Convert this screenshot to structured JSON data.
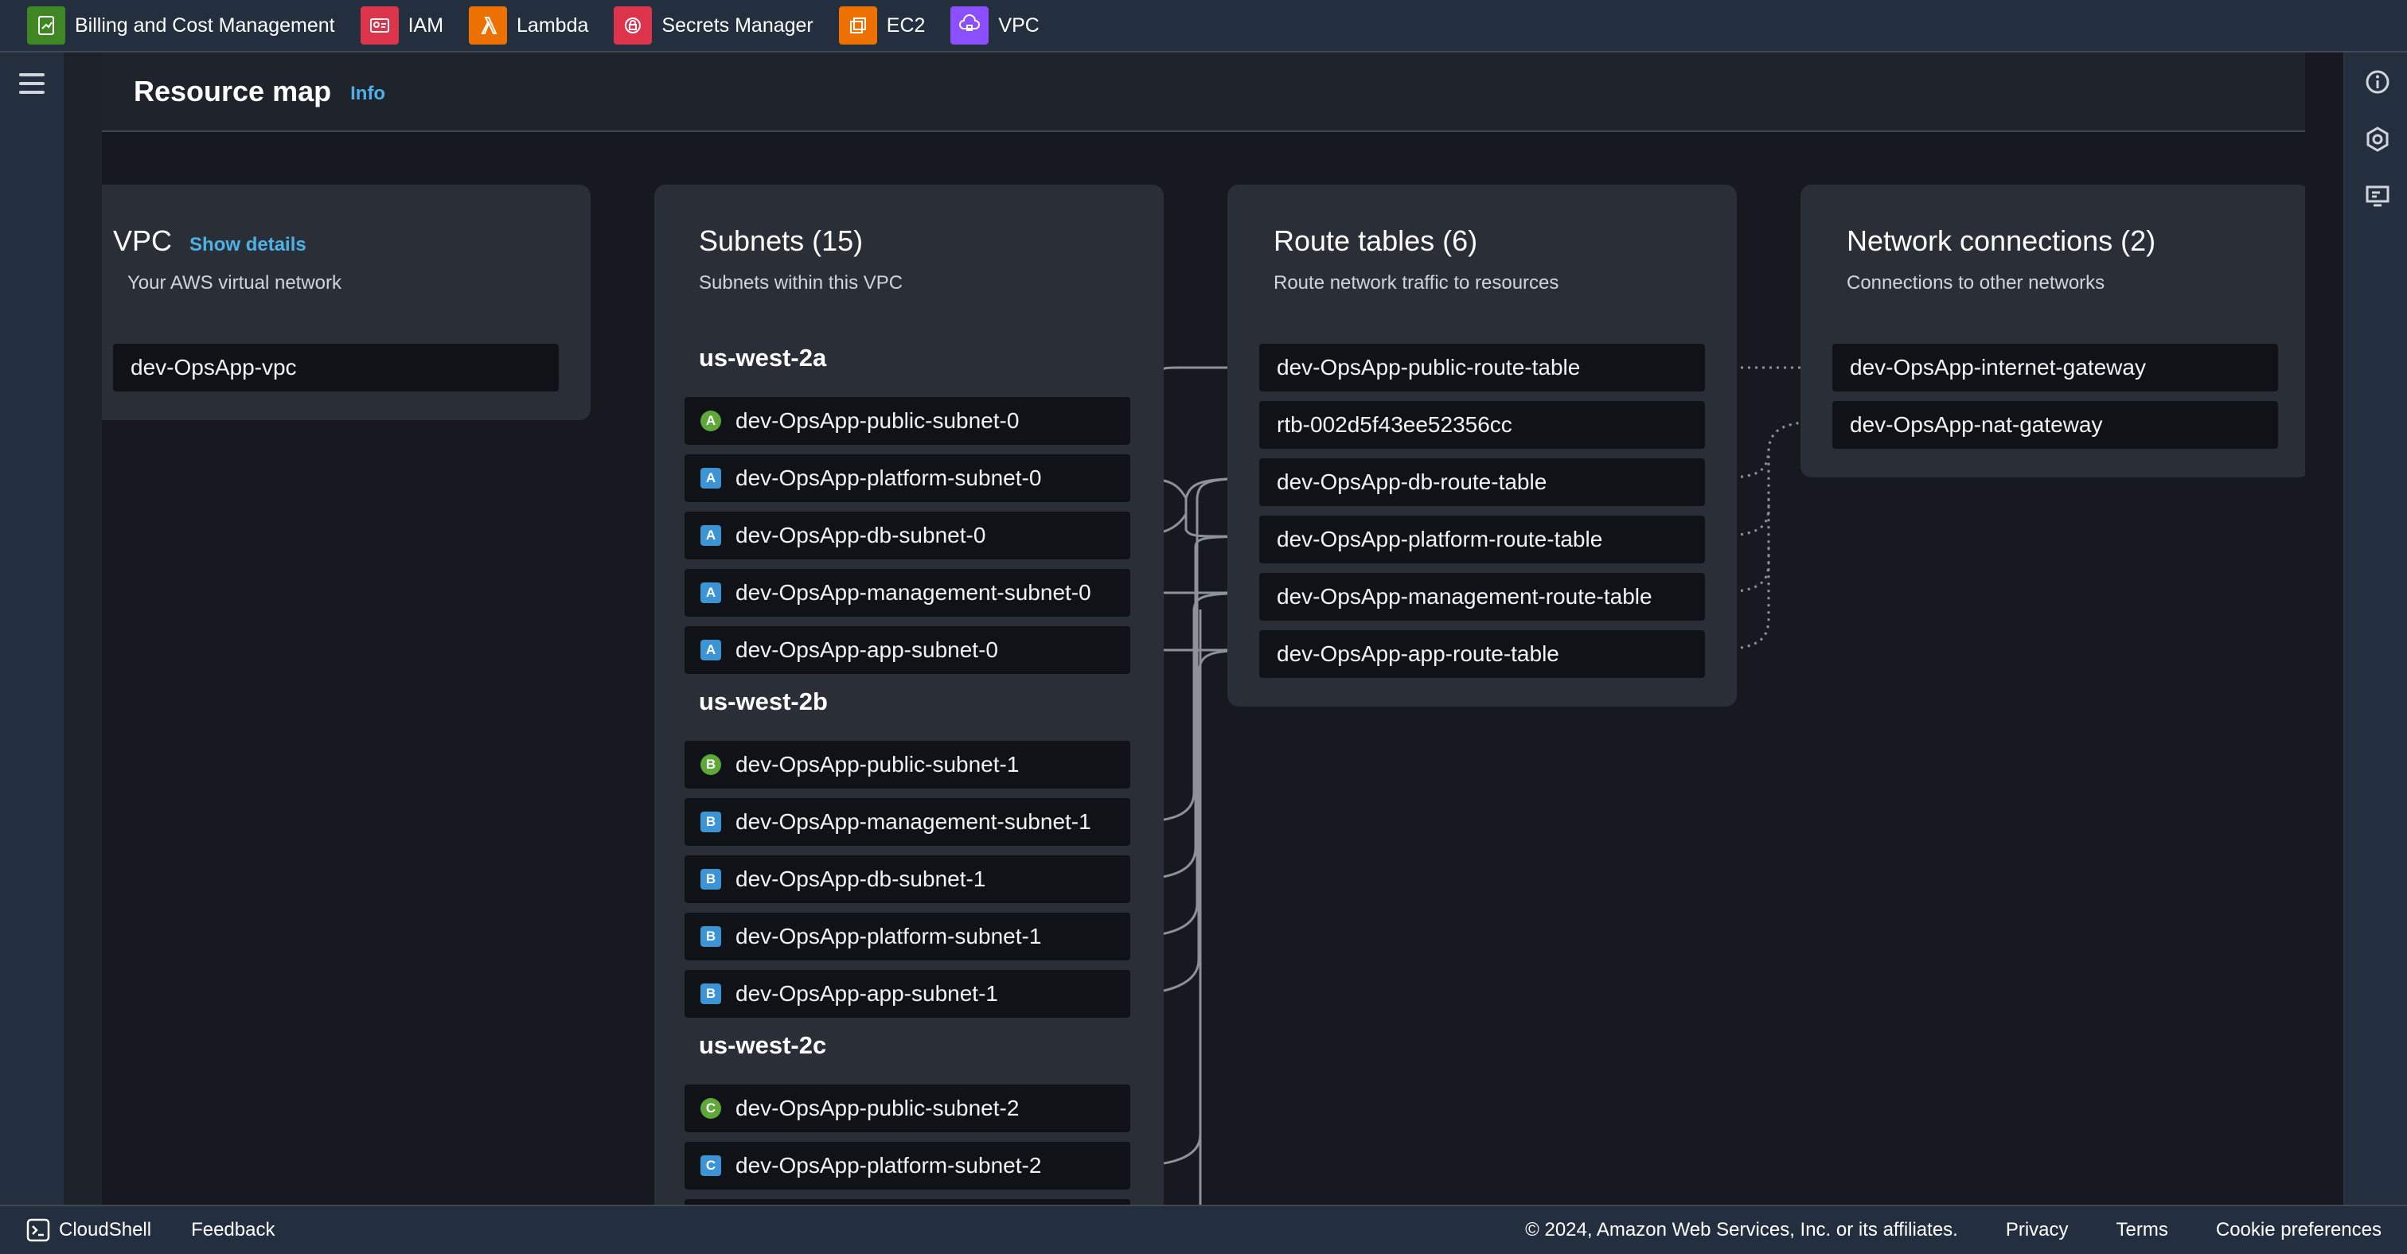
{
  "favorites": [
    {
      "label": "Billing and Cost Management",
      "icon": "billing-icon",
      "color": "#3f8624"
    },
    {
      "label": "IAM",
      "icon": "iam-icon",
      "color": "#dd344c"
    },
    {
      "label": "Lambda",
      "icon": "lambda-icon",
      "color": "#ed7100"
    },
    {
      "label": "Secrets Manager",
      "icon": "secrets-manager-icon",
      "color": "#dd344c"
    },
    {
      "label": "EC2",
      "icon": "ec2-icon",
      "color": "#ed7100"
    },
    {
      "label": "VPC",
      "icon": "vpc-icon",
      "color": "#8c4fff"
    }
  ],
  "header": {
    "title": "Resource map",
    "info": "Info"
  },
  "vpc_panel": {
    "title": "VPC",
    "show_details": "Show details",
    "subtitle": "Your AWS virtual network",
    "node": "dev-OpsApp-vpc"
  },
  "subnets_panel": {
    "title": "Subnets (15)",
    "subtitle": "Subnets within this VPC",
    "zones": [
      {
        "name": "us-west-2a",
        "subnets": [
          {
            "name": "dev-OpsApp-public-subnet-0",
            "badge": "A",
            "public": true
          },
          {
            "name": "dev-OpsApp-platform-subnet-0",
            "badge": "A",
            "public": false
          },
          {
            "name": "dev-OpsApp-db-subnet-0",
            "badge": "A",
            "public": false
          },
          {
            "name": "dev-OpsApp-management-subnet-0",
            "badge": "A",
            "public": false
          },
          {
            "name": "dev-OpsApp-app-subnet-0",
            "badge": "A",
            "public": false
          }
        ]
      },
      {
        "name": "us-west-2b",
        "subnets": [
          {
            "name": "dev-OpsApp-public-subnet-1",
            "badge": "B",
            "public": true
          },
          {
            "name": "dev-OpsApp-management-subnet-1",
            "badge": "B",
            "public": false
          },
          {
            "name": "dev-OpsApp-db-subnet-1",
            "badge": "B",
            "public": false
          },
          {
            "name": "dev-OpsApp-platform-subnet-1",
            "badge": "B",
            "public": false
          },
          {
            "name": "dev-OpsApp-app-subnet-1",
            "badge": "B",
            "public": false
          }
        ]
      },
      {
        "name": "us-west-2c",
        "subnets": [
          {
            "name": "dev-OpsApp-public-subnet-2",
            "badge": "C",
            "public": true
          },
          {
            "name": "dev-OpsApp-platform-subnet-2",
            "badge": "C",
            "public": false
          }
        ]
      }
    ]
  },
  "route_tables_panel": {
    "title": "Route tables (6)",
    "subtitle": "Route network traffic to resources",
    "tables": [
      "dev-OpsApp-public-route-table",
      "rtb-002d5f43ee52356cc",
      "dev-OpsApp-db-route-table",
      "dev-OpsApp-platform-route-table",
      "dev-OpsApp-management-route-table",
      "dev-OpsApp-app-route-table"
    ]
  },
  "network_panel": {
    "title": "Network connections (2)",
    "subtitle": "Connections to other networks",
    "connections": [
      "dev-OpsApp-internet-gateway",
      "dev-OpsApp-nat-gateway"
    ]
  },
  "footer": {
    "cloudshell": "CloudShell",
    "feedback": "Feedback",
    "copyright": "© 2024, Amazon Web Services, Inc. or its affiliates.",
    "privacy": "Privacy",
    "terms": "Terms",
    "cookies": "Cookie preferences"
  },
  "colors": {
    "link": "#4db1e6",
    "public_badge": "#5ea839",
    "private_badge": "#3d94d5",
    "connector": "#8d9299"
  }
}
